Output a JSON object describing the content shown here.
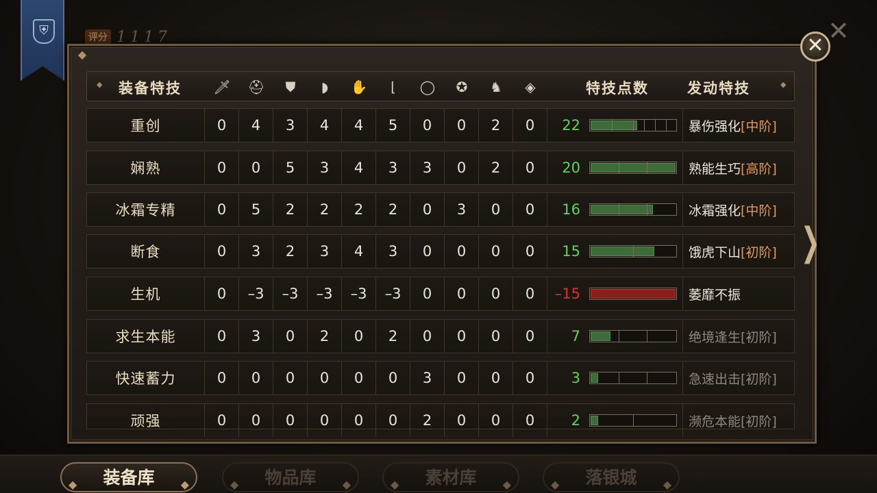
{
  "score": {
    "label": "评分",
    "value": "1117"
  },
  "header": {
    "skill_label": "装备特技",
    "points_label": "特技点数",
    "effect_label": "发动特技",
    "slot_icons": [
      "sword-icon",
      "helmet-icon",
      "chest-armor-icon",
      "shoulder-icon",
      "gauntlet-icon",
      "boots-icon",
      "ring-icon",
      "amulet-icon",
      "horse-icon",
      "gem-icon"
    ]
  },
  "rows": [
    {
      "name": "重创",
      "values": [
        "0",
        "4",
        "3",
        "4",
        "4",
        "5",
        "0",
        "0",
        "2",
        "0"
      ],
      "total": "22",
      "sign": "pos",
      "fill": 0.55,
      "ticks": [
        0.25,
        0.5,
        0.63,
        0.75,
        0.88
      ],
      "effect": "暴伤强化",
      "tier": "[中阶]",
      "dim": false
    },
    {
      "name": "娴熟",
      "values": [
        "0",
        "0",
        "5",
        "3",
        "4",
        "3",
        "3",
        "0",
        "2",
        "0"
      ],
      "total": "20",
      "sign": "pos",
      "fill": 1.0,
      "ticks": [
        0.33,
        0.66
      ],
      "effect": "熟能生巧",
      "tier": "[高阶]",
      "dim": false
    },
    {
      "name": "冰霜专精",
      "values": [
        "0",
        "5",
        "2",
        "2",
        "2",
        "2",
        "0",
        "3",
        "0",
        "0"
      ],
      "total": "16",
      "sign": "pos",
      "fill": 0.73,
      "ticks": [
        0.33,
        0.66
      ],
      "effect": "冰霜强化",
      "tier": "[中阶]",
      "dim": false
    },
    {
      "name": "断食",
      "values": [
        "0",
        "3",
        "2",
        "3",
        "4",
        "3",
        "0",
        "0",
        "0",
        "0"
      ],
      "total": "15",
      "sign": "pos",
      "fill": 0.75,
      "ticks": [
        0.5
      ],
      "effect": "饿虎下山",
      "tier": "[初阶]",
      "dim": false
    },
    {
      "name": "生机",
      "values": [
        "0",
        "–3",
        "–3",
        "–3",
        "–3",
        "–3",
        "0",
        "0",
        "0",
        "0"
      ],
      "total": "–15",
      "sign": "neg",
      "fill": 1.0,
      "ticks": [],
      "effect": "萎靡不振",
      "tier": "",
      "dim": false
    },
    {
      "name": "求生本能",
      "values": [
        "0",
        "3",
        "0",
        "2",
        "0",
        "2",
        "0",
        "0",
        "0",
        "0"
      ],
      "total": "7",
      "sign": "pos",
      "fill": 0.23,
      "ticks": [
        0.33,
        0.66
      ],
      "effect": "绝境逢生",
      "tier": "[初阶]",
      "dim": true
    },
    {
      "name": "快速蓄力",
      "values": [
        "0",
        "0",
        "0",
        "0",
        "0",
        "0",
        "3",
        "0",
        "0",
        "0"
      ],
      "total": "3",
      "sign": "pos",
      "fill": 0.09,
      "ticks": [
        0.33,
        0.66
      ],
      "effect": "急速出击",
      "tier": "[初阶]",
      "dim": true
    },
    {
      "name": "顽强",
      "values": [
        "0",
        "0",
        "0",
        "0",
        "0",
        "0",
        "2",
        "0",
        "0",
        "0"
      ],
      "total": "2",
      "sign": "pos",
      "fill": 0.09,
      "ticks": [
        0.5
      ],
      "effect": "濒危本能",
      "tier": "[初阶]",
      "dim": true
    }
  ],
  "tabs": [
    {
      "label": "装备库",
      "active": true
    },
    {
      "label": "物品库",
      "active": false
    },
    {
      "label": "素材库",
      "active": false
    },
    {
      "label": "落银城",
      "active": false
    }
  ],
  "colors": {
    "positive": "#5fd45a",
    "negative": "#e0322a",
    "tier": "#e59850",
    "bar_fill": "#3e6b3a",
    "bar_neg": "#8a1e1a"
  }
}
